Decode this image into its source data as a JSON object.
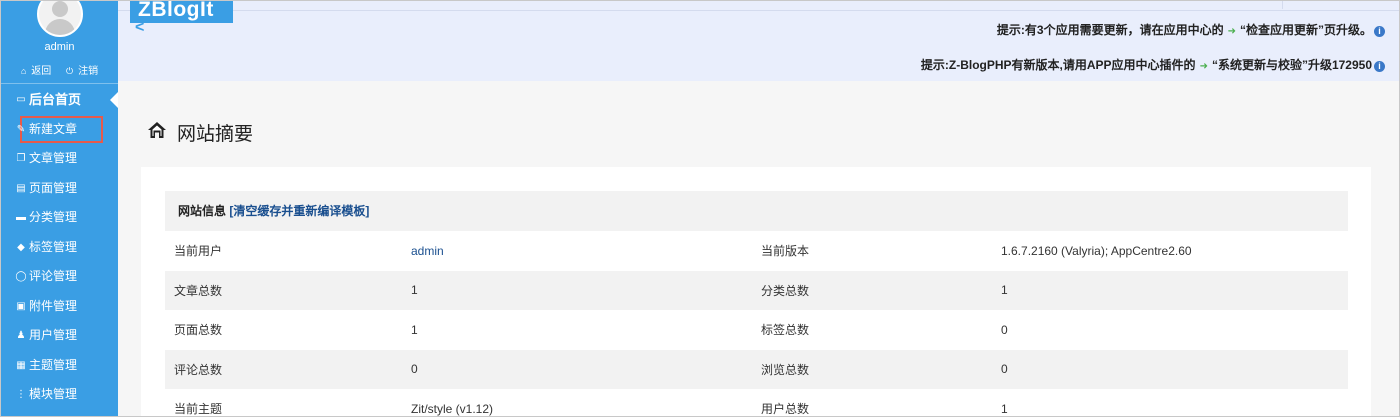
{
  "sidebar": {
    "username": "admin",
    "back_label": "返回",
    "logout_label": "注销",
    "items": [
      {
        "label": "后台首页",
        "icon": "window-icon"
      },
      {
        "label": "新建文章",
        "icon": "edit-icon"
      },
      {
        "label": "文章管理",
        "icon": "document-icon"
      },
      {
        "label": "页面管理",
        "icon": "page-icon"
      },
      {
        "label": "分类管理",
        "icon": "folder-icon"
      },
      {
        "label": "标签管理",
        "icon": "tag-icon"
      },
      {
        "label": "评论管理",
        "icon": "comment-icon"
      },
      {
        "label": "附件管理",
        "icon": "attachment-icon"
      },
      {
        "label": "用户管理",
        "icon": "user-icon"
      },
      {
        "label": "主题管理",
        "icon": "theme-icon"
      },
      {
        "label": "模块管理",
        "icon": "module-icon"
      }
    ]
  },
  "header": {
    "logo": "ZBlogIt",
    "notice1_prefix": "提示:有3个应用需要更新，请在应用中心的",
    "notice1_link": "“检查应用更新”页升级。",
    "notice2_prefix": "提示:Z-BlogPHP有新版本,请用APP应用中心插件的",
    "notice2_link": "“系统更新与校验”升级172950"
  },
  "main": {
    "page_title": "网站摘要",
    "info_title": "网站信息",
    "info_link": "[清空缓存并重新编译模板]",
    "rows": [
      {
        "k1": "当前用户",
        "v1": "admin",
        "k2": "当前版本",
        "v2": "1.6.7.2160 (Valyria); AppCentre2.60"
      },
      {
        "k1": "文章总数",
        "v1": "1",
        "k2": "分类总数",
        "v2": "1"
      },
      {
        "k1": "页面总数",
        "v1": "1",
        "k2": "标签总数",
        "v2": "0"
      },
      {
        "k1": "评论总数",
        "v1": "0",
        "k2": "浏览总数",
        "v2": "0"
      },
      {
        "k1": "当前主题",
        "v1": "Zit/style (v1.12)",
        "k2": "用户总数",
        "v2": "1"
      }
    ]
  },
  "colors": {
    "sidebar": "#3a9ee4",
    "topbar": "#e9eefc",
    "highlight": "#e85a4a",
    "link": "#1a4f8f"
  }
}
